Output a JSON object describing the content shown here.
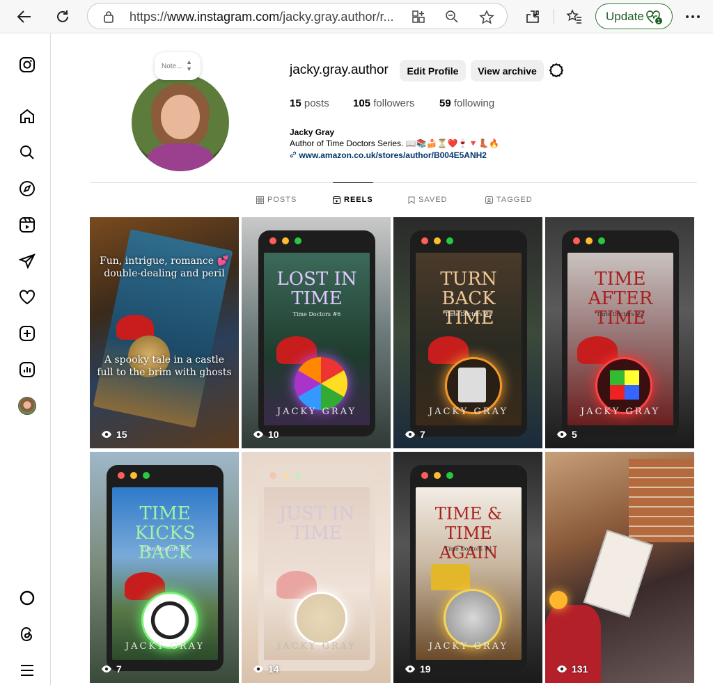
{
  "browser": {
    "url_prefix": "https://",
    "url_domain": "www.instagram.com",
    "url_path": "/jacky.gray.author/r...",
    "update_label": "Update",
    "update_badge": "1"
  },
  "note": {
    "label": "Note..."
  },
  "profile": {
    "username": "jacky.gray.author",
    "edit_label": "Edit Profile",
    "archive_label": "View archive",
    "posts_count": "15",
    "posts_label": "posts",
    "followers_count": "105",
    "followers_label": "followers",
    "following_count": "59",
    "following_label": "following",
    "name": "Jacky Gray",
    "bio": "Author of Time Doctors Series. 📖📚🍰⏳❤️🍷🔻👢🔥",
    "link": "www.amazon.co.uk/stores/author/B004E5ANH2"
  },
  "tabs": [
    {
      "label": "POSTS"
    },
    {
      "label": "REELS"
    },
    {
      "label": "SAVED"
    },
    {
      "label": "TAGGED"
    }
  ],
  "reels": [
    {
      "title": "",
      "subtitle": "",
      "author": "",
      "overlay_top": "Fun, intrigue, romance 💕 double-dealing and peril",
      "overlay_bottom": "A spooky tale in a castle full to the brim with ghosts",
      "views": "15"
    },
    {
      "title": "LOST IN TIME",
      "subtitle": "Time Doctors #6",
      "author": "JACKY GRAY",
      "views": "10"
    },
    {
      "title": "TURN BACK TIME",
      "subtitle": "Time Doctors #5",
      "author": "JACKY GRAY",
      "views": "7"
    },
    {
      "title": "TIME AFTER TIME",
      "subtitle": "Time Doctors #4",
      "author": "JACKY GRAY",
      "views": "5"
    },
    {
      "title": "TIME KICKS BACK",
      "subtitle": "Time Doctors #3",
      "author": "JACKY GRAY",
      "views": "7"
    },
    {
      "title": "JUST IN TIME",
      "subtitle": "",
      "author": "JACKY GRAY",
      "views": "14"
    },
    {
      "title": "TIME & TIME AGAIN",
      "subtitle": "Time Doctors #1",
      "author": "JACKY GRAY",
      "views": "19"
    },
    {
      "title": "",
      "subtitle": "",
      "author": "",
      "views": "131"
    }
  ],
  "colors": {
    "accent_green": "#2e7d32",
    "link_blue": "#00376b",
    "traffic_red": "#ff5f57",
    "traffic_yellow": "#febc2e",
    "traffic_green": "#28c840"
  }
}
